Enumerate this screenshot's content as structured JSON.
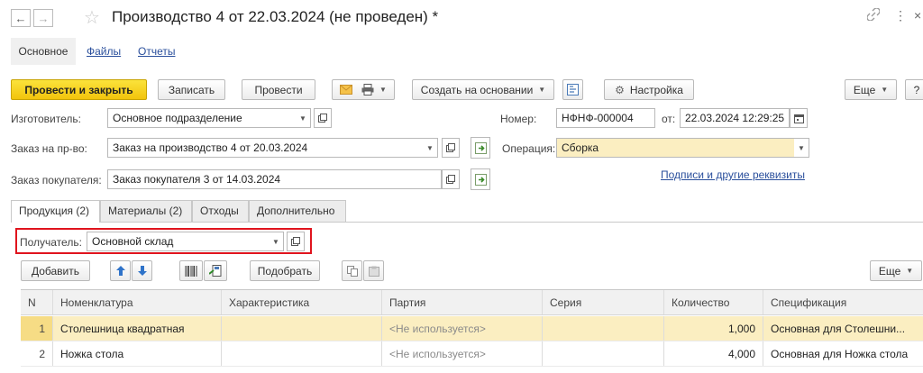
{
  "window": {
    "title": "Производство 4 от 22.03.2024 (не проведен) *"
  },
  "nav_tabs": [
    {
      "label": "Основное"
    },
    {
      "label": "Файлы"
    },
    {
      "label": "Отчеты"
    }
  ],
  "toolbar": {
    "post_close": "Провести и закрыть",
    "save": "Записать",
    "post": "Провести",
    "create_based": "Создать на основании",
    "settings": "Настройка",
    "more": "Еще",
    "help": "?"
  },
  "form": {
    "maker_label": "Изготовитель:",
    "maker_value": "Основное подразделение",
    "number_label": "Номер:",
    "number_value": "НФНФ-000004",
    "date_label": "от:",
    "date_value": "22.03.2024 12:29:25",
    "order_label": "Заказ на пр-во:",
    "order_value": "Заказ на производство 4 от 20.03.2024",
    "operation_label": "Операция:",
    "operation_value": "Сборка",
    "customer_order_label": "Заказ покупателя:",
    "customer_order_value": "Заказ покупателя 3 от 14.03.2024",
    "signatures_link": "Подписи и другие реквизиты"
  },
  "inner_tabs": [
    {
      "label": "Продукция (2)"
    },
    {
      "label": "Материалы (2)"
    },
    {
      "label": "Отходы"
    },
    {
      "label": "Дополнительно"
    }
  ],
  "recipient": {
    "label": "Получатель:",
    "value": "Основной склад"
  },
  "table_toolbar": {
    "add": "Добавить",
    "select": "Подобрать",
    "more": "Еще"
  },
  "table": {
    "columns": [
      "N",
      "Номенклатура",
      "Характеристика",
      "Партия",
      "Серия",
      "Количество",
      "Спецификация"
    ],
    "rows": [
      {
        "n": "1",
        "item": "Столешница квадратная",
        "char": "",
        "batch": "<Не используется>",
        "series": "",
        "qty": "1,000",
        "spec": "Основная для Столешни..."
      },
      {
        "n": "2",
        "item": "Ножка стола",
        "char": "",
        "batch": "<Не используется>",
        "series": "",
        "qty": "4,000",
        "spec": "Основная для Ножка стола"
      }
    ]
  },
  "colors": {
    "primary": "#f2c40c",
    "selection": "#fbeec1",
    "link": "#2a4f9c",
    "highlight_border": "#e0141e"
  }
}
